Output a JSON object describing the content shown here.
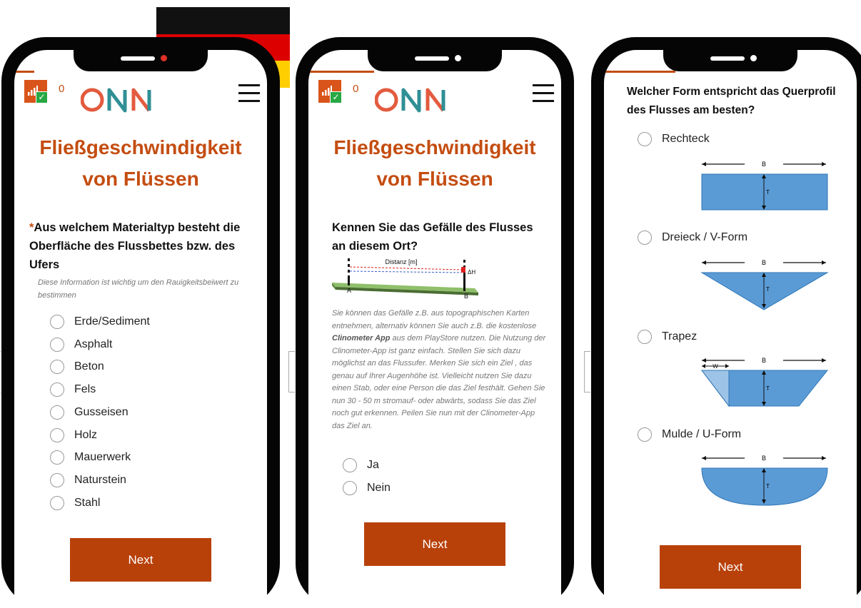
{
  "colors": {
    "accent": "#c44d11",
    "button": "#b8410a",
    "shape_fill": "#5b9bd5",
    "shape_stroke": "#2e75b6"
  },
  "phone1": {
    "counter": "0",
    "logo": "ONN",
    "title_line1": "Fließgeschwindigkeit",
    "title_line2": "von Flüssen",
    "required_marker": "*",
    "question": "Aus welchem Materialtyp besteht die Oberfläche des Flussbettes bzw. des Ufers",
    "hint": "Diese Information ist wichtig um den Rauigkeitsbeiwert zu bestimmen",
    "options": [
      "Erde/Sediment",
      "Asphalt",
      "Beton",
      "Fels",
      "Gusseisen",
      "Holz",
      "Mauerwerk",
      "Naturstein",
      "Stahl"
    ],
    "next_label": "Next"
  },
  "phone2": {
    "counter": "0",
    "logo": "ONN",
    "title_line1": "Fließgeschwindigkeit",
    "title_line2": "von Flüssen",
    "question": "Kennen Sie das Gefälle des Flusses an diesem Ort?",
    "diagram": {
      "distance_label": "Distanz [m]",
      "dh_label": "ΔH",
      "point_a": "A",
      "point_b": "B"
    },
    "hint_part1": "Sie können das Gefälle z.B. aus topographischen Karten entnehmen, alternativ können Sie auch z.B. die kostenlose ",
    "hint_bold": "Clinometer App",
    "hint_part2": " aus dem PlayStore nutzen. Die Nutzung der Clinometer-App ist ganz einfach. Stellen Sie sich dazu möglichst an das Flussufer. Merken Sie sich ein Ziel , das genau auf Ihrer Augenhöhe ist. Vielleicht nutzen Sie dazu einen Stab, oder eine Person die das Ziel festhält. Gehen Sie nun 30 - 50 m stromauf- oder abwärts, sodass Sie das Ziel noch gut erkennen. Peilen Sie nun mit der Clinometer-App das Ziel an.",
    "options": [
      "Ja",
      "Nein"
    ],
    "next_label": "Next"
  },
  "phone3": {
    "question": "Welcher Form entspricht das Querprofil des Flusses am besten?",
    "shapes": [
      {
        "label": "Rechteck",
        "width_label": "B",
        "depth_label": "T"
      },
      {
        "label": "Dreieck / V-Form",
        "width_label": "B",
        "depth_label": "T"
      },
      {
        "label": "Trapez",
        "width_label": "B",
        "depth_label": "T",
        "w_label": "W"
      },
      {
        "label": "Mulde / U-Form",
        "width_label": "B",
        "depth_label": "T"
      }
    ],
    "next_label": "Next"
  }
}
